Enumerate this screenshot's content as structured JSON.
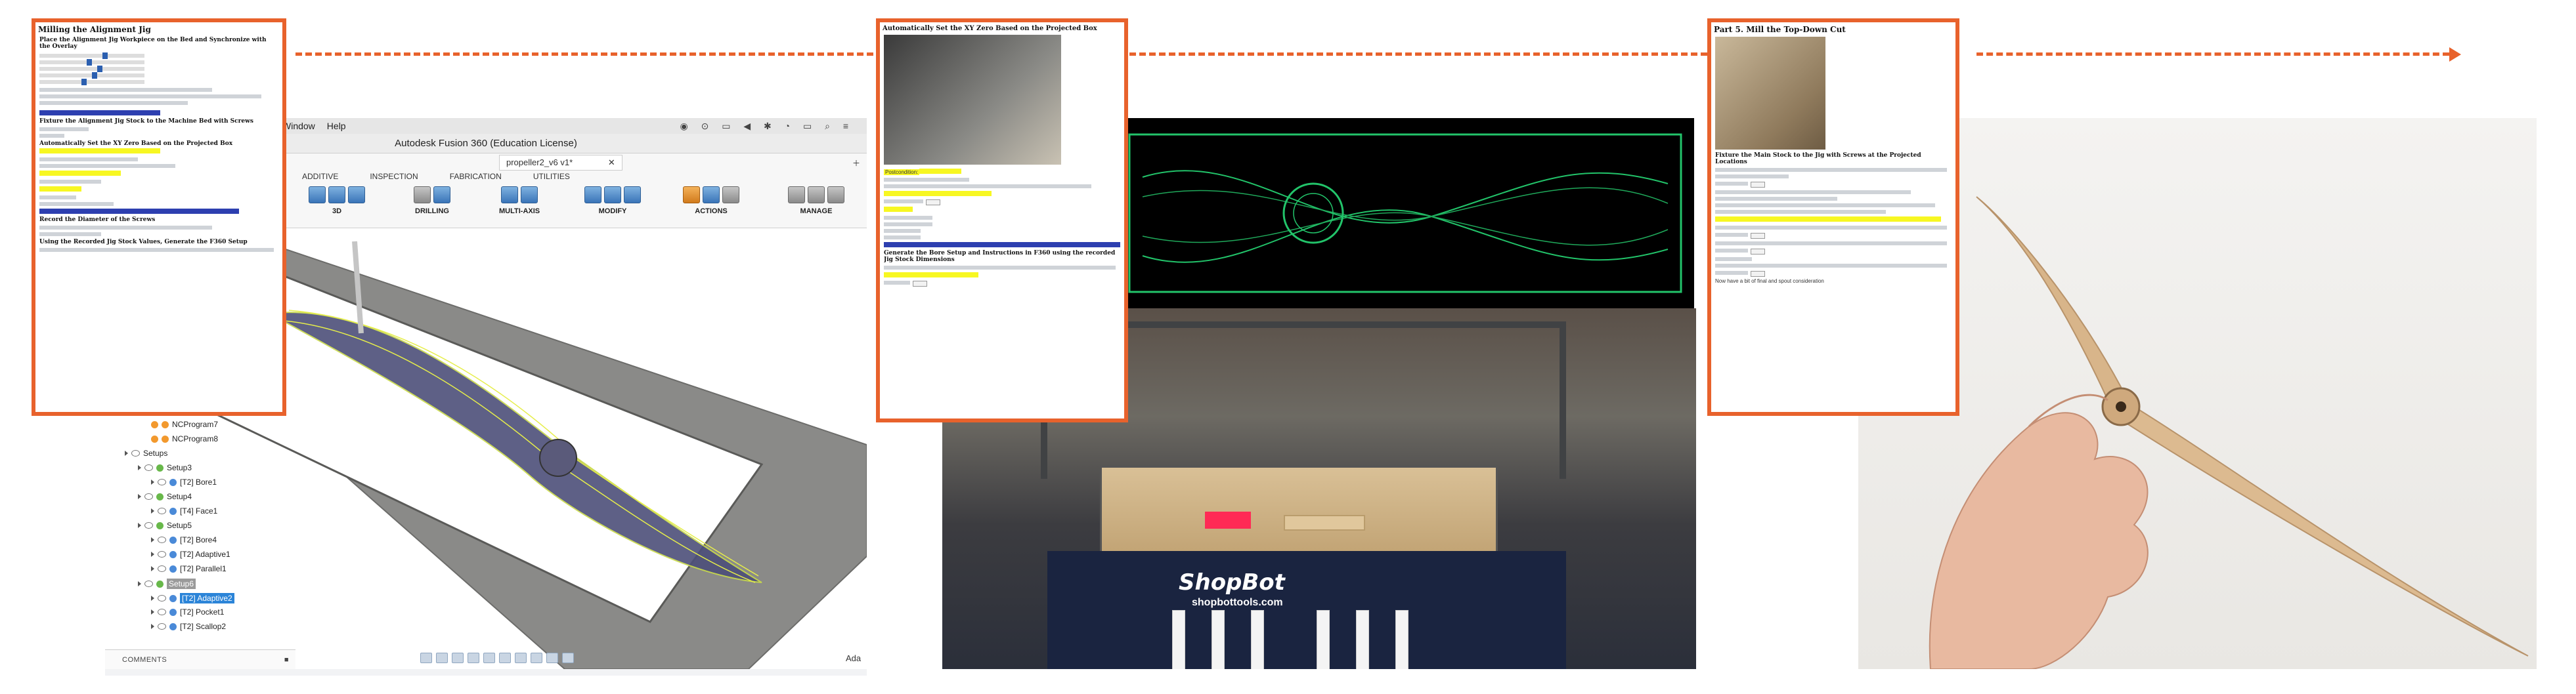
{
  "fusion": {
    "mac_menu": [
      "Window",
      "Help"
    ],
    "window_title": "Autodesk Fusion 360 (Education License)",
    "doc_tab": "propeller2_v6 v1*",
    "ribbon_tabs": [
      "ADDITIVE",
      "INSPECTION",
      "FABRICATION",
      "UTILITIES"
    ],
    "ribbon_groups": [
      "3D",
      "DRILLING",
      "MULTI-AXIS",
      "MODIFY",
      "ACTIONS",
      "MANAGE"
    ],
    "browser_tree": {
      "top_items": [
        "NCProgram7",
        "NCProgram8"
      ],
      "setups_label": "Setups",
      "rows": [
        {
          "label": "Setup3",
          "level": 1
        },
        {
          "label": "[T2] Bore1",
          "level": 2
        },
        {
          "label": "Setup4",
          "level": 1
        },
        {
          "label": "[T4] Face1",
          "level": 2
        },
        {
          "label": "Setup5",
          "level": 1
        },
        {
          "label": "[T2] Bore4",
          "level": 2
        },
        {
          "label": "[T2] Adaptive1",
          "level": 2
        },
        {
          "label": "[T2] Parallel1",
          "level": 2
        },
        {
          "label": "Setup6",
          "level": 1
        },
        {
          "label": "[T2] Adaptive2",
          "level": 2
        },
        {
          "label": "[T2] Pocket1",
          "level": 2
        },
        {
          "label": "[T2] Scallop2",
          "level": 2
        }
      ]
    },
    "comments_label": "COMMENTS",
    "ada_label": "Ada"
  },
  "docs": {
    "doc1": {
      "title": "Milling the Alignment Jig",
      "subtitle": "Place the Alignment Jig Workpiece on the Bed and Synchronize with the Overlay",
      "line_fix": "Fixture the Alignment Jig Stock to the Machine Bed with Screws",
      "line_xy": "Automatically Set the XY Zero Based on the Projected Box",
      "line_record": "Record the Diameter of the Screws",
      "line_gen": "Using the Recorded Jig Stock Values, Generate the F360 Setup"
    },
    "doc2": {
      "title": "Automatically Set the XY Zero Based on the Projected Box",
      "line_gen": "Generate the Bore Setup and Instructions in F360 using the recorded Jig Stock Dimensions",
      "postcondition": "Postcondition:"
    },
    "doc3": {
      "title": "Part 5. Mill the Top-Down Cut",
      "subtitle": "Fixture the Main Stock to the Jig with Screws at the Projected Locations",
      "note": "Now have a bit of final and spout consideration"
    }
  },
  "shopbot": {
    "logo": "ShopBot",
    "url": "shopbottools.com"
  },
  "colors": {
    "accent": "#e8622c",
    "highlight": "#f7f722",
    "toolpath": "#22c46a"
  }
}
